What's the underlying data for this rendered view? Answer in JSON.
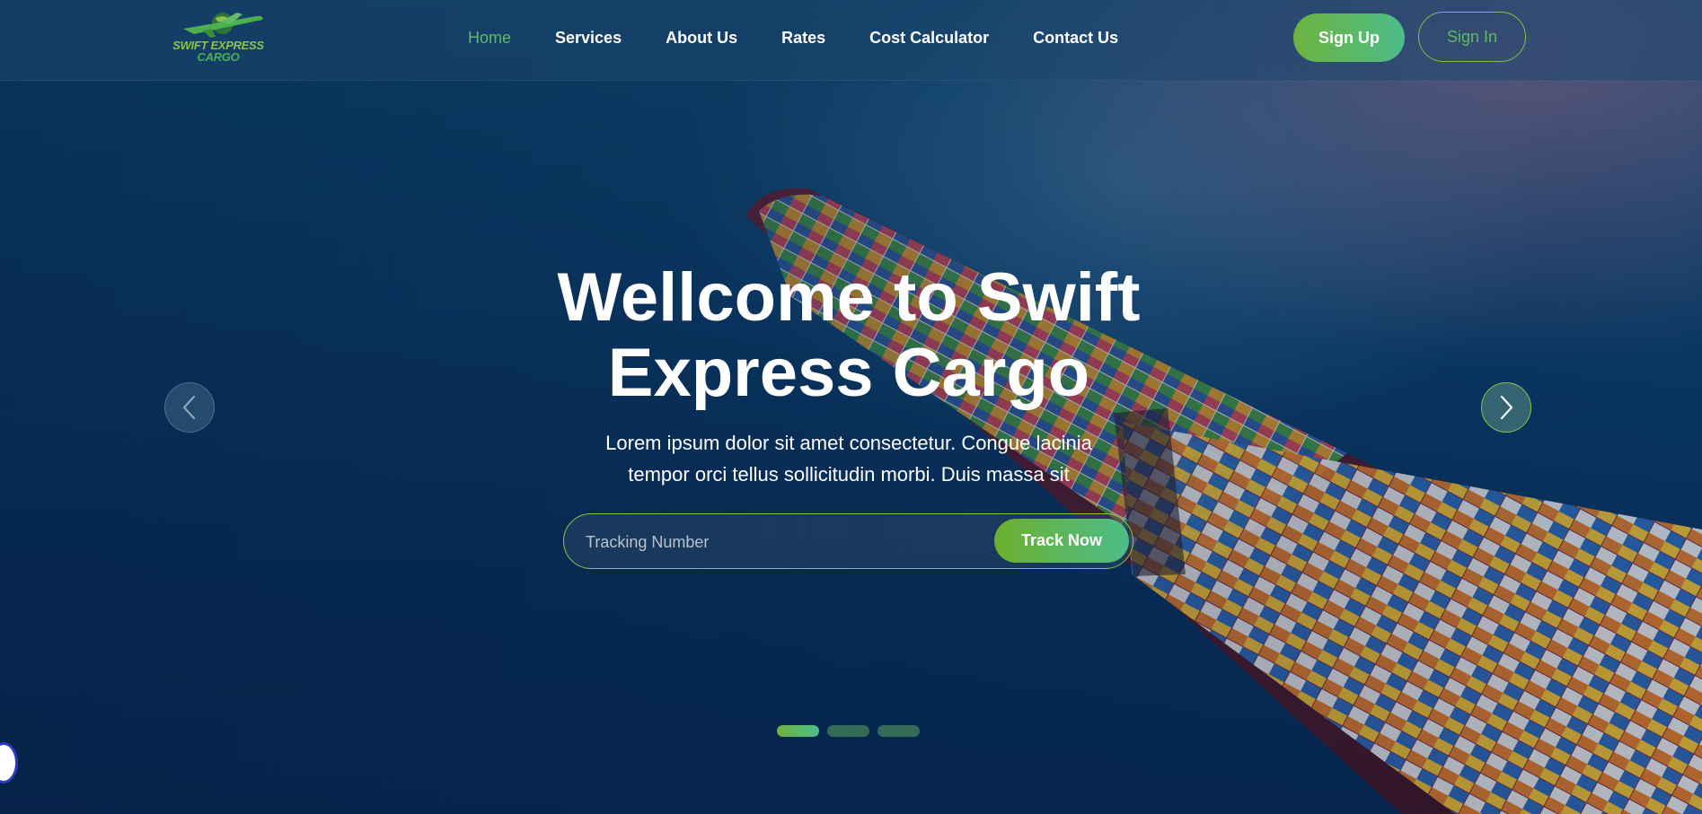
{
  "header": {
    "logo": {
      "line1": "SWIFT EXPRESS",
      "line2": "CARGO"
    },
    "nav": [
      {
        "label": "Home",
        "active": true
      },
      {
        "label": "Services",
        "active": false
      },
      {
        "label": "About Us",
        "active": false
      },
      {
        "label": "Rates",
        "active": false
      },
      {
        "label": "Cost Calculator",
        "active": false
      },
      {
        "label": "Contact Us",
        "active": false
      }
    ],
    "sign_up_label": "Sign Up",
    "sign_in_label": "Sign In"
  },
  "hero": {
    "title_line1": "Wellcome to Swift",
    "title_line2": "Express Cargo",
    "subtitle_line1": "Lorem ipsum dolor sit amet consectetur. Congue lacinia",
    "subtitle_line2": "tempor orci tellus sollicitudin morbi. Duis massa sit",
    "tracking": {
      "placeholder": "Tracking Number",
      "value": "",
      "button_label": "Track Now"
    },
    "carousel": {
      "prev_icon": "chevron-left-icon",
      "next_icon": "chevron-right-icon",
      "slide_count": 3,
      "active_slide": 1
    }
  },
  "colors": {
    "accent_green": "#5dbb63",
    "gradient_start": "#6db33f",
    "gradient_end": "#4cbd8a",
    "header_bg": "#1e466e",
    "text_white": "#ffffff"
  },
  "icons": {
    "logo": "plane-globe-logo-icon",
    "accessibility": "accessibility-icon"
  }
}
